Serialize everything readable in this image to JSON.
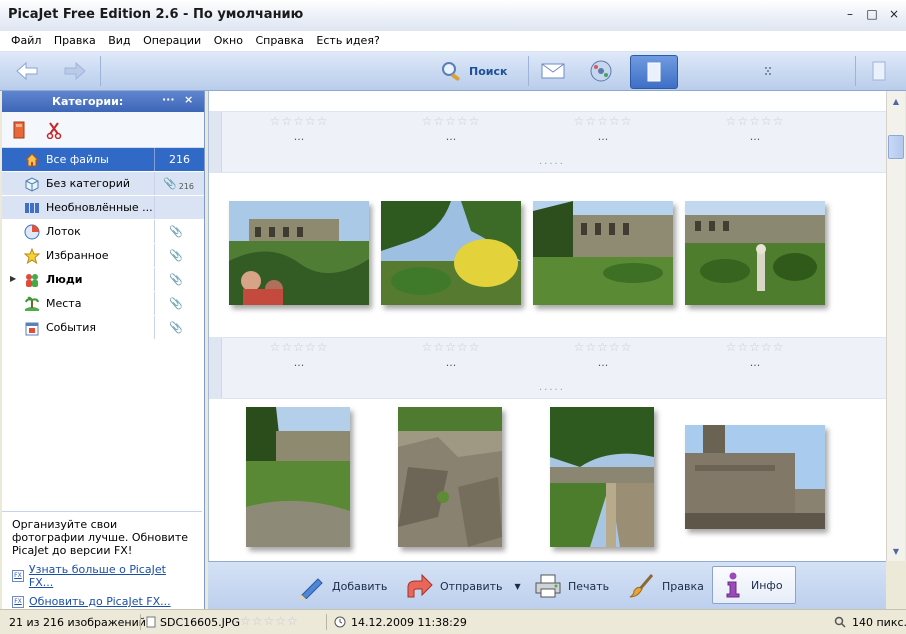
{
  "window": {
    "title": "PicaJet Free Edition 2.6  - По умолчанию",
    "controls": [
      "–",
      "□",
      "×"
    ]
  },
  "menu": [
    "Файл",
    "Правка",
    "Вид",
    "Операции",
    "Окно",
    "Справка",
    "Есть идея?"
  ],
  "toolbar": {
    "back_icon": "back-arrow-icon",
    "forward_icon": "forward-arrow-icon",
    "search_label": "Поиск"
  },
  "categories": {
    "header": "Категории:",
    "header_dots": "···",
    "header_close": "×",
    "items": [
      {
        "label": "Все файлы",
        "count": "216",
        "icon": "home-icon",
        "selected": true
      },
      {
        "label": "Без категорий",
        "count": "216",
        "icon": "box-icon"
      },
      {
        "label": "Необновлённые ...",
        "count": "",
        "icon": "stack-icon"
      },
      {
        "label": "Лоток",
        "count": "",
        "icon": "tray-icon"
      },
      {
        "label": "Избранное",
        "count": "",
        "icon": "star-icon"
      },
      {
        "label": "Люди",
        "count": "",
        "icon": "people-icon",
        "bold": true
      },
      {
        "label": "Места",
        "count": "",
        "icon": "places-icon"
      },
      {
        "label": "События",
        "count": "",
        "icon": "events-icon"
      }
    ]
  },
  "promo": {
    "text": "Организуйте свои фотографии лучше. Обновите PicaJet до версии FX!",
    "link1": "Узнать больше о PicaJet FX...",
    "link2": "Обновить до PicaJet FX...",
    "badge": "FX"
  },
  "grid": {
    "stars": "☆☆☆☆☆",
    "ellipsis": "...",
    "band_dots": ".....",
    "thumbnails": [
      {
        "name": "photo-ruins-people"
      },
      {
        "name": "photo-garden-flowers"
      },
      {
        "name": "photo-villa-hill"
      },
      {
        "name": "photo-garden-statue"
      },
      {
        "name": "photo-tree-wall"
      },
      {
        "name": "photo-stone-ruins"
      },
      {
        "name": "photo-hedge-path"
      },
      {
        "name": "photo-column-ruins"
      }
    ]
  },
  "actions": [
    {
      "label": "Добавить",
      "icon": "add-pen-icon"
    },
    {
      "label": "Отправить",
      "icon": "send-arrow-icon",
      "dropdown": "▼"
    },
    {
      "label": "Печать",
      "icon": "printer-icon"
    },
    {
      "label": "Правка",
      "icon": "brush-icon"
    },
    {
      "label": "Инфо",
      "icon": "info-icon",
      "selected": true
    }
  ],
  "status": {
    "count": "21 из 216 изображений",
    "file": "SDC16605.JPG",
    "stars": "☆☆☆☆☆",
    "date": "14.12.2009 11:38:29",
    "zoom": "140 пикс."
  }
}
